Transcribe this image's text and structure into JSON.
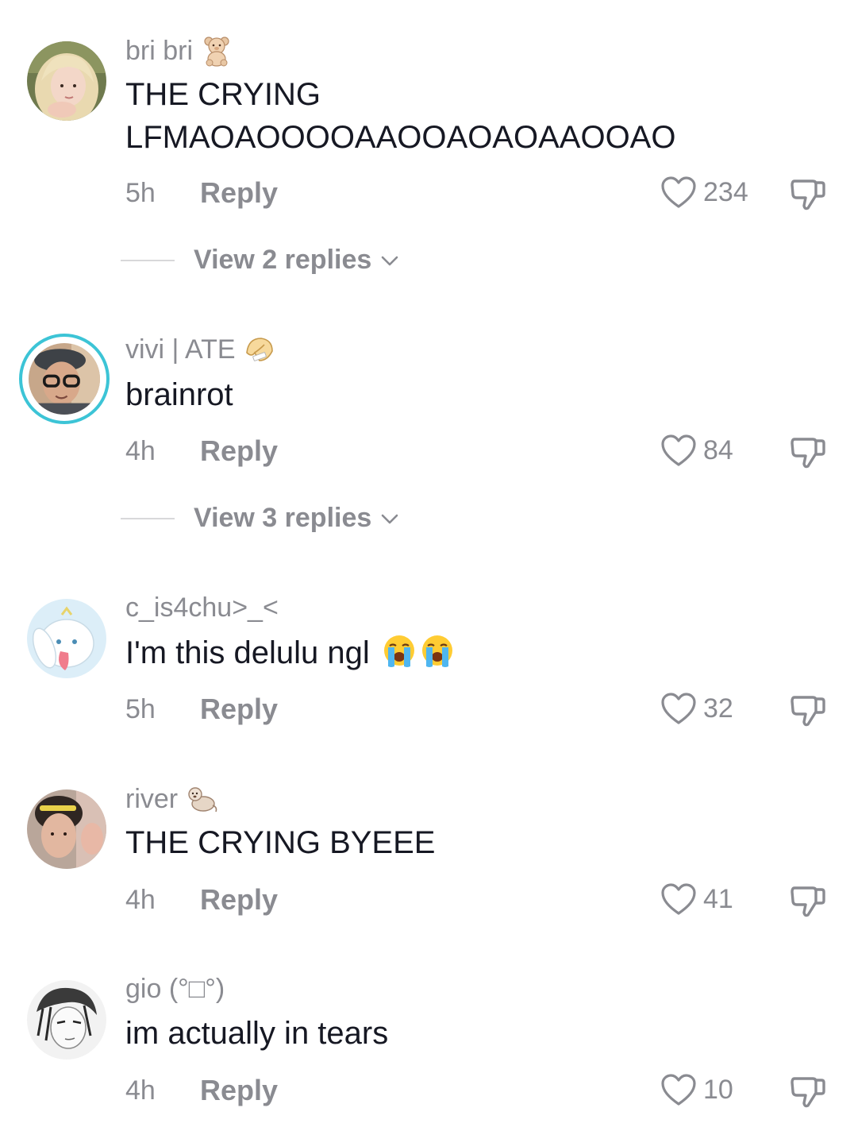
{
  "comments": [
    {
      "username": "bri bri",
      "badge": "teddy-bear-emoji",
      "text_line1": "THE CRYING",
      "text_line2": "LFMAOAOOOOAAOOAOAOAAOOAO",
      "time": "5h",
      "reply_label": "Reply",
      "likes": "234",
      "view_replies": "View 2 replies"
    },
    {
      "username": "vivi | ATE",
      "badge": "fortune-cookie-emoji",
      "text": "brainrot",
      "time": "4h",
      "reply_label": "Reply",
      "likes": "84",
      "view_replies": "View 3 replies",
      "avatar_ring_color": "#3cc4d6"
    },
    {
      "username": "c_is4chu>_<",
      "text": "I'm this delulu ngl",
      "trailing_emoji": [
        "loudly-crying-face-emoji",
        "loudly-crying-face-emoji"
      ],
      "time": "5h",
      "reply_label": "Reply",
      "likes": "32"
    },
    {
      "username": "river",
      "badge": "otter-emoji",
      "text": "THE CRYING BYEEE",
      "time": "4h",
      "reply_label": "Reply",
      "likes": "41"
    },
    {
      "username": "gio (°□°)",
      "text": "im actually in tears",
      "time": "4h",
      "reply_label": "Reply",
      "likes": "10"
    }
  ],
  "colors": {
    "text_primary": "#161823",
    "text_secondary": "#8a8b91",
    "divider": "#d8d8da"
  }
}
